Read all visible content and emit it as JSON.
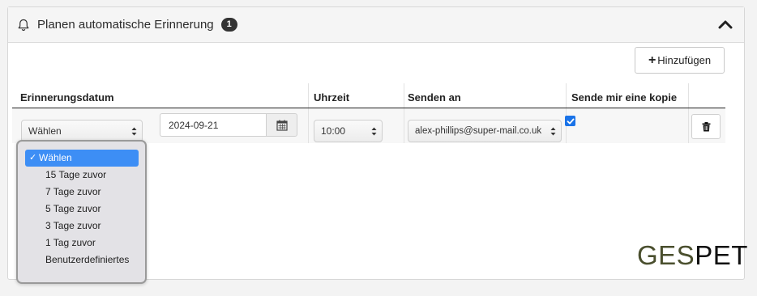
{
  "panel": {
    "title": "Planen automatische Erinnerung",
    "badge": "1",
    "add_button_label": "Hinzufügen"
  },
  "table": {
    "headers": [
      "Erinnerungsdatum",
      "Uhrzeit",
      "Senden an",
      "Sende mir eine kopie"
    ],
    "row": {
      "reminder_select": "Wählen",
      "date": "2024-09-21",
      "time": "10:00",
      "send_to": "alex-phillips@super-mail.co.uk",
      "send_copy_checked": true
    }
  },
  "dropdown": {
    "selected": "Wählen",
    "options": [
      "Wählen",
      "15 Tage zuvor",
      "7 Tage zuvor",
      "5 Tage zuvor",
      "3 Tage zuvor",
      "1 Tag zuvor",
      "Benutzerdefiniertes"
    ]
  },
  "logo": {
    "part1": "GES",
    "part2": "PET"
  },
  "colors": {
    "accent": "#3d8ef5",
    "logo_green": "#4a4f2e"
  }
}
